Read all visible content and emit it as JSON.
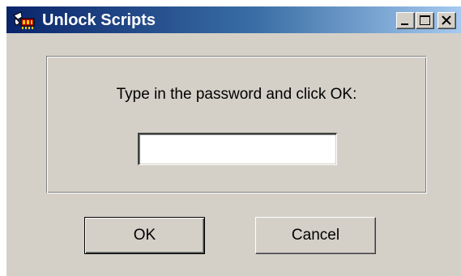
{
  "window": {
    "title": "Unlock Scripts",
    "controls": {
      "minimize": "minimize-icon",
      "maximize": "maximize-icon",
      "close": "close-icon"
    }
  },
  "dialog": {
    "prompt": "Type in the password and click OK:",
    "password_value": "",
    "ok_label": "OK",
    "cancel_label": "Cancel"
  },
  "colors": {
    "titlebar_start": "#0a246a",
    "titlebar_end": "#a6caf0",
    "face": "#d4d0c8"
  }
}
